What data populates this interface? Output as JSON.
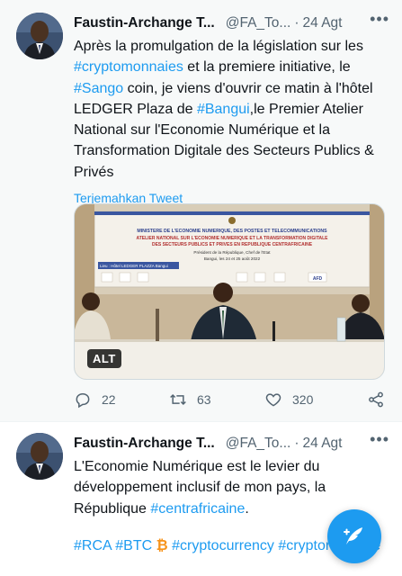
{
  "tweets": [
    {
      "author_name": "Faustin-Archange T...",
      "handle": "@FA_To...",
      "separator": "·",
      "time": "24 Agt",
      "text_segments": [
        {
          "text": "Après la promulgation de la législation sur les ",
          "link": false
        },
        {
          "text": "#cryptomonnaies",
          "link": true
        },
        {
          "text": " et la premiere initiative, le ",
          "link": false
        },
        {
          "text": "#Sango",
          "link": true
        },
        {
          "text": " coin, je viens d'ouvrir ce matin à l'hôtel LEDGER Plaza de ",
          "link": false
        },
        {
          "text": "#Bangui",
          "link": true
        },
        {
          "text": ",le Premier Atelier National sur l'Economie Numérique et la Transformation Digitale des Secteurs Publics & Privés",
          "link": false
        }
      ],
      "translate_label": "Terjemahkan Tweet",
      "media": {
        "alt_badge": "ALT",
        "banner_lines": [
          "MINISTERE DE L'ECONOMIE NUMERIQUE, DES POSTES ET TELECOMMUNICATIONS",
          "ATELIER NATIONAL SUR L'ECONOMIE NUMERIQUE ET LA TRANSFORMATION DIGITALE",
          "DES SECTEURS PUBLICS ET PRIVES EN REPUBLIQUE CENTRAFRICAINE",
          "Président de la République, Chef de l'Etat",
          "Bangui, les 24 et 25 août 2022"
        ],
        "venue_label": "Lieu : Hôtel LEDGER PLAZZA Bangui",
        "logo_label": "AFD"
      },
      "actions": {
        "reply_count": "22",
        "retweet_count": "63",
        "like_count": "320"
      }
    },
    {
      "author_name": "Faustin-Archange T...",
      "handle": "@FA_To...",
      "separator": "·",
      "time": "24 Agt",
      "text_segments": [
        {
          "text": "L'Economie Numérique est le levier du développement inclusif de mon pays, la République ",
          "link": false
        },
        {
          "text": "#centrafricaine",
          "link": true
        },
        {
          "text": ".",
          "link": false
        }
      ],
      "hashtag_segments": [
        {
          "text": "#RCA",
          "link": true
        },
        {
          "text": " ",
          "link": false
        },
        {
          "text": "#BTC",
          "link": true
        },
        {
          "text": " ₿ ",
          "link": false,
          "bitcoin": true
        },
        {
          "text": "#cryptocurrency",
          "link": true
        },
        {
          "text": " ",
          "link": false
        },
        {
          "text": "#cryptomonnaie",
          "link": true
        }
      ]
    }
  ],
  "colors": {
    "accent": "#1d9bf0",
    "secondary_text": "#536471",
    "primary_text": "#0f1419",
    "bitcoin": "#f7931a"
  },
  "icons": {
    "reply": "comment-bubble-icon",
    "retweet": "retweet-icon",
    "like": "heart-icon",
    "share": "share-icon",
    "more": "more-dots-icon",
    "compose": "compose-tweet-icon"
  }
}
